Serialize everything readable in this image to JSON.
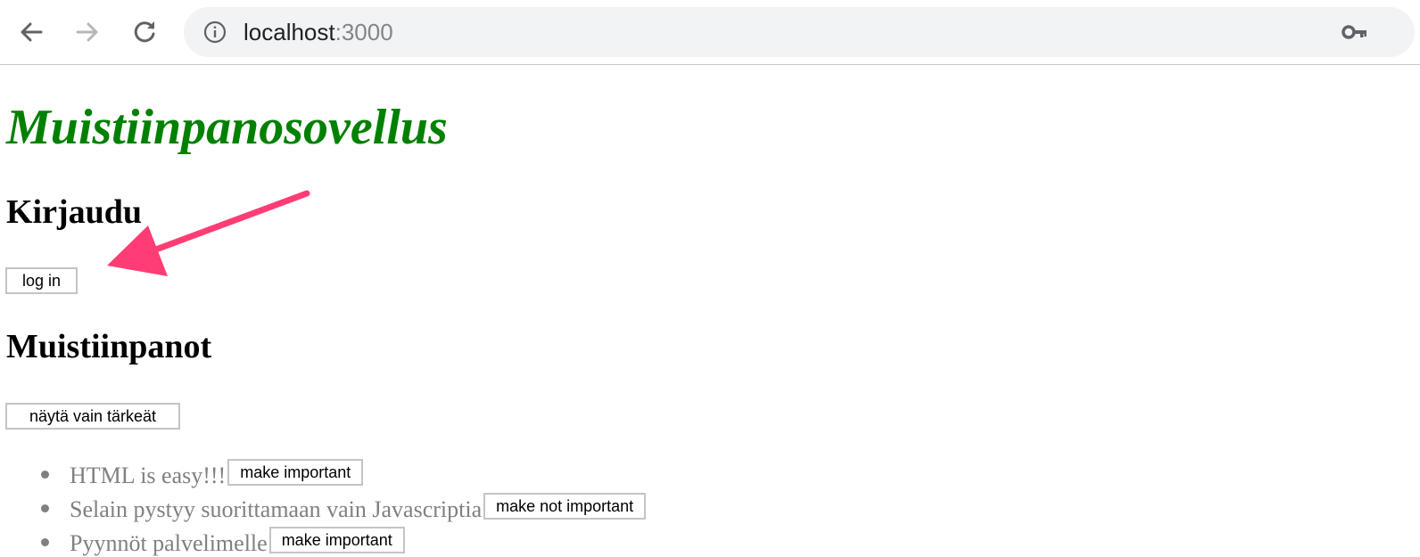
{
  "browser": {
    "url_host": "localhost",
    "url_port": ":3000",
    "icons": {
      "back": "arrow-left-icon",
      "forward": "arrow-right-icon",
      "reload": "reload-icon",
      "site_info": "info-icon",
      "passwords": "key-icon"
    }
  },
  "app": {
    "title": "Muistiinpanosovellus",
    "title_color": "#008000",
    "login": {
      "heading": "Kirjaudu",
      "button_label": "log in"
    },
    "notes": {
      "heading": "Muistiinpanot",
      "filter_button_label": "näytä vain tärkeät",
      "items": [
        {
          "content": "HTML is easy!!!",
          "button_label": "make important"
        },
        {
          "content": "Selain pystyy suorittamaan vain Javascriptia",
          "button_label": "make not important"
        },
        {
          "content": "Pyynnöt palvelimelle",
          "button_label": "make important"
        }
      ]
    }
  },
  "annotation": {
    "type": "arrow",
    "color": "#ff3d74"
  }
}
